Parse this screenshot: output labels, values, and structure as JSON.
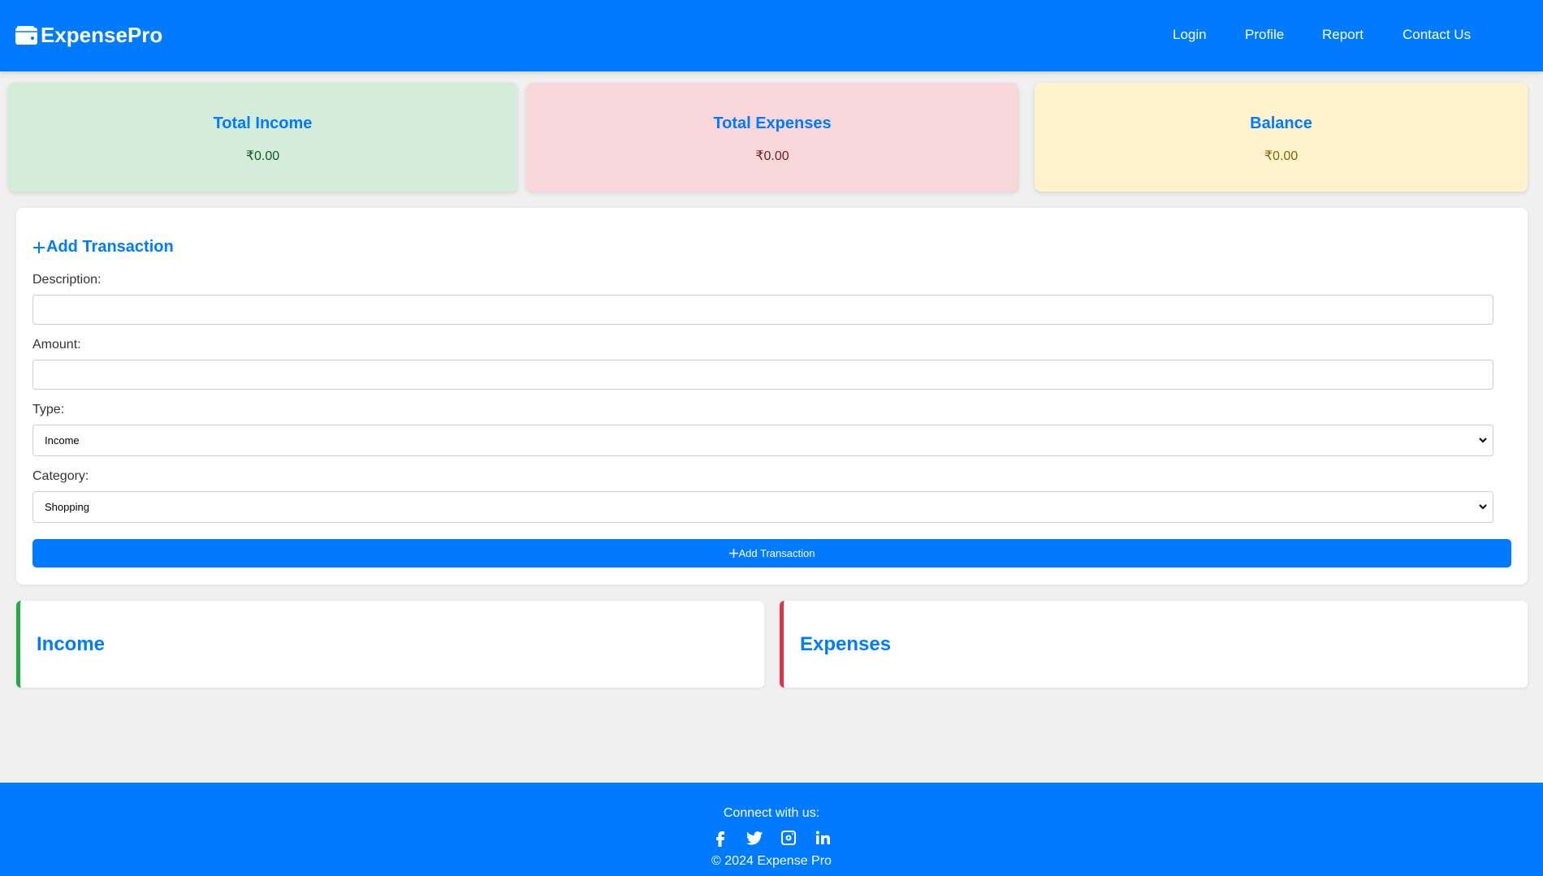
{
  "app": {
    "brand": "ExpensePro"
  },
  "nav": {
    "links": [
      "Login",
      "Profile",
      "Report",
      "Contact Us"
    ]
  },
  "summary": {
    "income": {
      "title": "Total Income",
      "amount": "₹0.00"
    },
    "expenses": {
      "title": "Total Expenses",
      "amount": "₹0.00"
    },
    "balance": {
      "title": "Balance",
      "amount": "₹0.00"
    }
  },
  "form": {
    "title": "Add Transaction",
    "description_label": "Description:",
    "description_value": "",
    "amount_label": "Amount:",
    "amount_value": "",
    "type_label": "Type:",
    "type_selected": "Income",
    "category_label": "Category:",
    "category_selected": "Shopping",
    "submit_label": "Add Transaction"
  },
  "lists": {
    "income_title": "Income",
    "expenses_title": "Expenses"
  },
  "footer": {
    "connect": "Connect with us:",
    "socials": [
      "facebook-icon",
      "twitter-icon",
      "instagram-icon",
      "linkedin-icon"
    ],
    "copyright": "© 2024 Expense Pro"
  },
  "colors": {
    "primary": "#007bff",
    "income_bg": "#d4edda",
    "expense_bg": "#f8d7da",
    "balance_bg": "#fff3cd",
    "income_border": "#28a745",
    "expense_border": "#dc3545"
  }
}
